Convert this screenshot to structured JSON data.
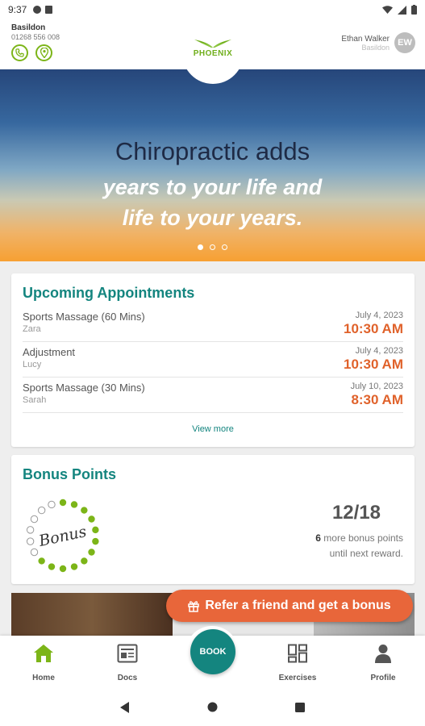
{
  "status_bar": {
    "time": "9:37"
  },
  "clinic": {
    "name": "Basildon",
    "phone": "01268 556 008"
  },
  "logo": {
    "text": "PHOENIX",
    "color": "#6fae1a"
  },
  "user": {
    "name": "Ethan Walker",
    "location": "Basildon",
    "initials": "EW"
  },
  "hero": {
    "line1": "Chiropractic adds",
    "line2": "years to your life and",
    "line3": "life to your years.",
    "slide_count": 3,
    "active_slide": 1
  },
  "appointments": {
    "title": "Upcoming Appointments",
    "items": [
      {
        "service": "Sports Massage (60 Mins)",
        "practitioner": "Zara",
        "date": "July 4, 2023",
        "time": "10:30 AM"
      },
      {
        "service": "Adjustment",
        "practitioner": "Lucy",
        "date": "July 4, 2023",
        "time": "10:30 AM"
      },
      {
        "service": "Sports Massage (30 Mins)",
        "practitioner": "Sarah",
        "date": "July 10, 2023",
        "time": "8:30 AM"
      }
    ],
    "view_more": "View more"
  },
  "bonus": {
    "title": "Bonus Points",
    "ring_label": "Bonus",
    "earned": 12,
    "total": 18,
    "count_text": "12/18",
    "remaining": "6",
    "note_rest": " more bonus points",
    "note_line2": "until next reward."
  },
  "promo": {
    "refer_label": "Refer a friend and get a bonus"
  },
  "bottom_nav": {
    "home": "Home",
    "docs": "Docs",
    "book": "BOOK",
    "exercises": "Exercises",
    "profile": "Profile"
  },
  "colors": {
    "accent": "#14857f",
    "brand_green": "#7cb518",
    "time_orange": "#e0622b",
    "refer_orange": "#e8663a"
  }
}
